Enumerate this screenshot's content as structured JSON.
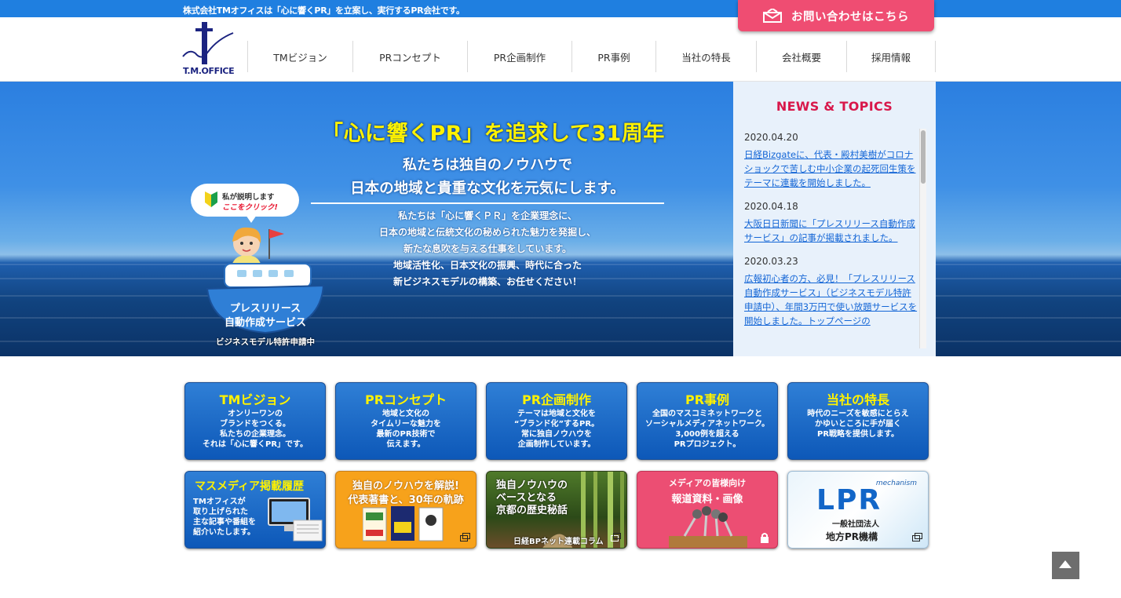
{
  "topbar": {
    "tagline": "株式会社TMオフィスは「心に響くPR」を立案し、実行するPR会社です。"
  },
  "contact": {
    "label": "お問い合わせはこちら"
  },
  "logo": {
    "text": "T.M.OFFICE"
  },
  "nav": [
    "TMビジョン",
    "PRコンセプト",
    "PR企画制作",
    "PR事例",
    "当社の特長",
    "会社概要",
    "採用情報"
  ],
  "hero": {
    "title": "「心に響くPR」を追求して31周年",
    "sub1": "私たちは独自のノウハウで",
    "sub2": "日本の地域と貴重な文化を元気にします。",
    "body": [
      "私たちは「心に響くＰＲ」を企業理念に、",
      "日本の地域と伝統文化の秘められた魅力を発掘し、",
      "新たな息吹を与える仕事をしています。",
      "地域活性化、日本文化の振興、時代に合った",
      "新ビジネスモデルの構築、お任せください！"
    ],
    "bubble1": "私が説明します",
    "bubble2": "ここをクリック!",
    "boat1": "プレスリリース",
    "boat2": "自動作成サービス",
    "boat_caption": "ビジネスモデル特許申請中"
  },
  "news": {
    "title": "NEWS & TOPICS",
    "items": [
      {
        "date": "2020.04.20",
        "text": "日経Bizgateに、代表・殿村美樹がコロナショックで苦しむ中小企業の起死回生策をテーマに連載を開始しました。"
      },
      {
        "date": "2020.04.18",
        "text": "大阪日日新聞に「プレスリリース自動作成サービス」の記事が掲載されました。"
      },
      {
        "date": "2020.03.23",
        "text": "広報初心者の方、必見！「プレスリリース自動作成サービス」（ビジネスモデル特許申請中）、年間3万円で使い放題サービスを開始しました。トップページの"
      }
    ]
  },
  "cards": [
    {
      "title": "TMビジョン",
      "desc": [
        "オンリーワンの",
        "ブランドをつくる。",
        "私たちの企業理念。",
        "それは「心に響くPR」です。"
      ]
    },
    {
      "title": "PRコンセプト",
      "desc": [
        "地域と文化の",
        "タイムリーな魅力を",
        "最新のPR技術で",
        "伝えます。"
      ]
    },
    {
      "title": "PR企画制作",
      "desc": [
        "テーマは地域と文化を",
        "“ブランド化”するPR。",
        "常に独自ノウハウを",
        "企画制作しています。"
      ]
    },
    {
      "title": "PR事例",
      "desc": [
        "全国のマスコミネットワークと",
        "ソーシャルメディアネットワーク。",
        "3,000例を超える",
        "PRプロジェクト。"
      ]
    },
    {
      "title": "当社の特長",
      "desc": [
        "時代のニーズを敏感にとらえ",
        "かゆいところに手が届く",
        "PR戦略を提供します。"
      ]
    }
  ],
  "banners": {
    "media": {
      "title": "マスメディア掲載履歴",
      "desc": [
        "TMオフィスが",
        "取り上げられた",
        "主な記事や番組を",
        "紹介いたします。"
      ]
    },
    "book": {
      "line1": "独自のノウハウを解説!",
      "line2": "代表著書と、30年の軌跡"
    },
    "kyoto": {
      "line1": "独自ノウハウの",
      "line2": "ベースとなる",
      "line3": "京都の歴史秘話",
      "caption": "日経BPネット連載コラム"
    },
    "press": {
      "line1": "メディアの皆様向け",
      "line2": "報道資料・画像"
    },
    "lpr": {
      "mechanism": "mechanism",
      "logo": "LPR",
      "line1": "一般社団法人",
      "line2": "地方PR機構"
    }
  },
  "colors": {
    "topbar": "#1f7fe0",
    "contact": "#ef4d72",
    "news_title": "#d8174a",
    "link": "#1466d6",
    "card_title": "#fff200"
  }
}
